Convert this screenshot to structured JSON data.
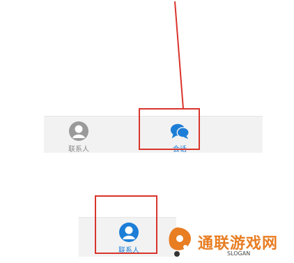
{
  "top_tabbar": {
    "tabs": [
      {
        "label": "联系人",
        "icon": "person-icon",
        "state": "inactive"
      },
      {
        "label": "会话",
        "icon": "chat-bubbles-icon",
        "state": "active"
      }
    ]
  },
  "bottom_tabbar": {
    "tabs": [
      {
        "label": "联系人",
        "icon": "person-icon",
        "state": "active"
      }
    ]
  },
  "annotations": {
    "highlight_color": "#d9342b",
    "arrow_color": "#d9342b"
  },
  "colors": {
    "active": "#1c7ed6",
    "inactive": "#8a8a8a",
    "tabbar_bg": "#f2f2f2",
    "watermark_orange": "#e87d22"
  },
  "watermark": {
    "title": "通联游戏网",
    "slogan": "SLOGAN"
  }
}
